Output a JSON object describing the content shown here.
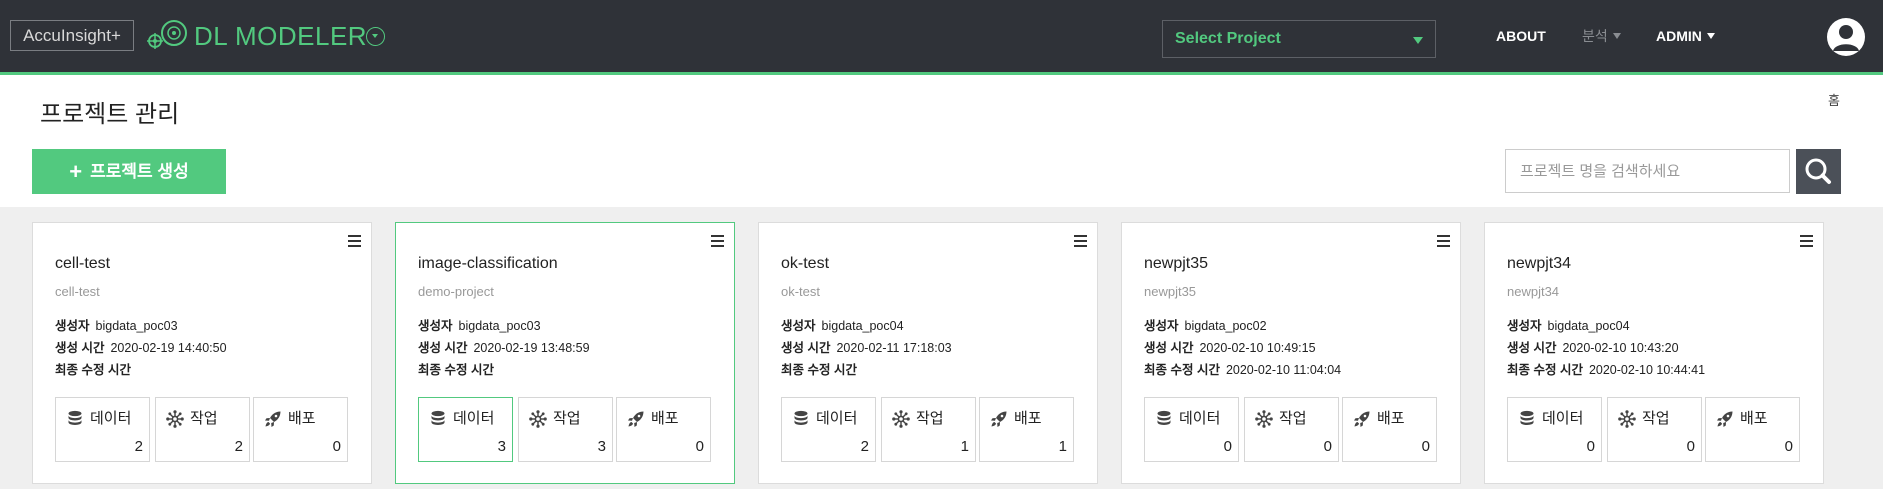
{
  "topbar": {
    "brand_box": "AccuInsight+",
    "app_name": "DL MODELER",
    "project_select": "Select Project",
    "nav": {
      "about": "ABOUT",
      "analysis": "분석",
      "admin": "ADMIN"
    }
  },
  "header": {
    "breadcrumb_home": "홈",
    "title": "프로젝트 관리",
    "create_button": "프로젝트 생성",
    "search_placeholder": "프로젝트 명을 검색하세요"
  },
  "labels": {
    "creator": "생성자",
    "created": "생성 시간",
    "modified": "최종 수정 시간",
    "data": "데이터",
    "jobs": "작업",
    "deploy": "배포"
  },
  "cards": [
    {
      "name": "cell-test",
      "desc": "cell-test",
      "creator": "bigdata_poc03",
      "created": "2020-02-19 14:40:50",
      "modified": "",
      "data": "2",
      "jobs": "2",
      "deploy": "0"
    },
    {
      "name": "image-classification",
      "desc": "demo-project",
      "creator": "bigdata_poc03",
      "created": "2020-02-19 13:48:59",
      "modified": "",
      "data": "3",
      "jobs": "3",
      "deploy": "0"
    },
    {
      "name": "ok-test",
      "desc": "ok-test",
      "creator": "bigdata_poc04",
      "created": "2020-02-11 17:18:03",
      "modified": "",
      "data": "2",
      "jobs": "1",
      "deploy": "1"
    },
    {
      "name": "newpjt35",
      "desc": "newpjt35",
      "creator": "bigdata_poc02",
      "created": "2020-02-10 10:49:15",
      "modified": "2020-02-10 11:04:04",
      "data": "0",
      "jobs": "0",
      "deploy": "0"
    },
    {
      "name": "newpjt34",
      "desc": "newpjt34",
      "creator": "bigdata_poc04",
      "created": "2020-02-10 10:43:20",
      "modified": "2020-02-10 10:44:41",
      "data": "0",
      "jobs": "0",
      "deploy": "0"
    }
  ],
  "colors": {
    "accent": "#52c97f",
    "topbar": "#2f3238"
  },
  "icons": {
    "data": "database-icon",
    "jobs": "gear-network-icon",
    "deploy": "rocket-icon",
    "search": "search-icon",
    "user": "user-icon",
    "menu": "hamburger-menu-icon"
  }
}
